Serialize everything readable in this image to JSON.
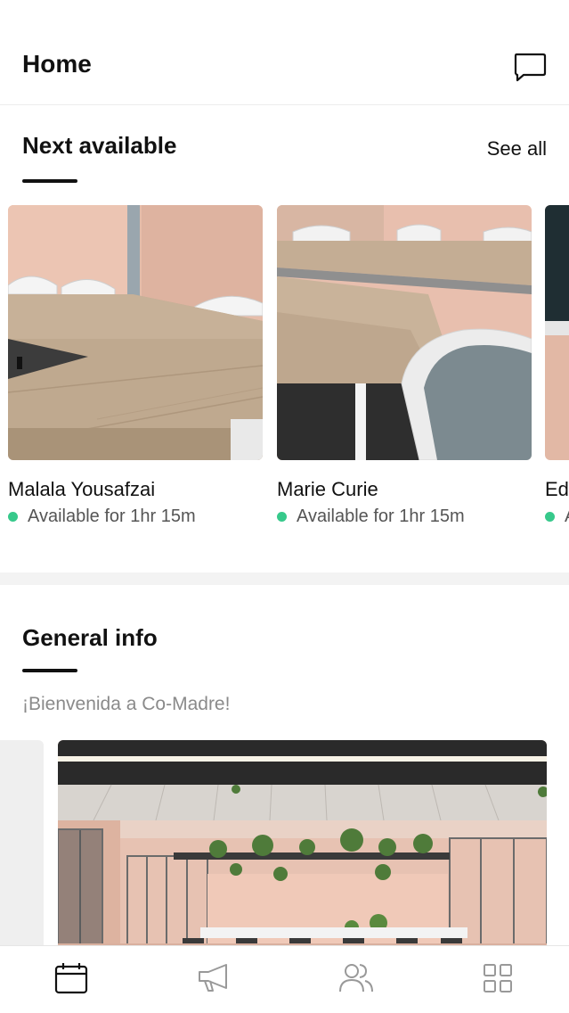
{
  "header": {
    "title": "Home",
    "chat_icon": "chat-bubble-icon"
  },
  "next_available": {
    "title": "Next available",
    "see_all": "See all",
    "rooms": [
      {
        "name": "Malala Yousafzai",
        "status": "Available for 1hr 15m",
        "status_color": "#37c98b"
      },
      {
        "name": "Marie Curie",
        "status": "Available for 1hr 15m",
        "status_color": "#37c98b"
      },
      {
        "name": "Ed",
        "status": "A",
        "status_color": "#37c98b"
      }
    ]
  },
  "general_info": {
    "title": "General info",
    "welcome": "¡Bienvenida a Co-Madre!"
  },
  "tabbar": {
    "tabs": [
      {
        "icon": "calendar-icon",
        "active": true
      },
      {
        "icon": "megaphone-icon",
        "active": false
      },
      {
        "icon": "people-icon",
        "active": false
      },
      {
        "icon": "grid-icon",
        "active": false
      }
    ]
  },
  "colors": {
    "accent": "#111111",
    "available": "#37c98b",
    "muted": "#8a8a8a",
    "room_wall": "#e3b9a6"
  }
}
